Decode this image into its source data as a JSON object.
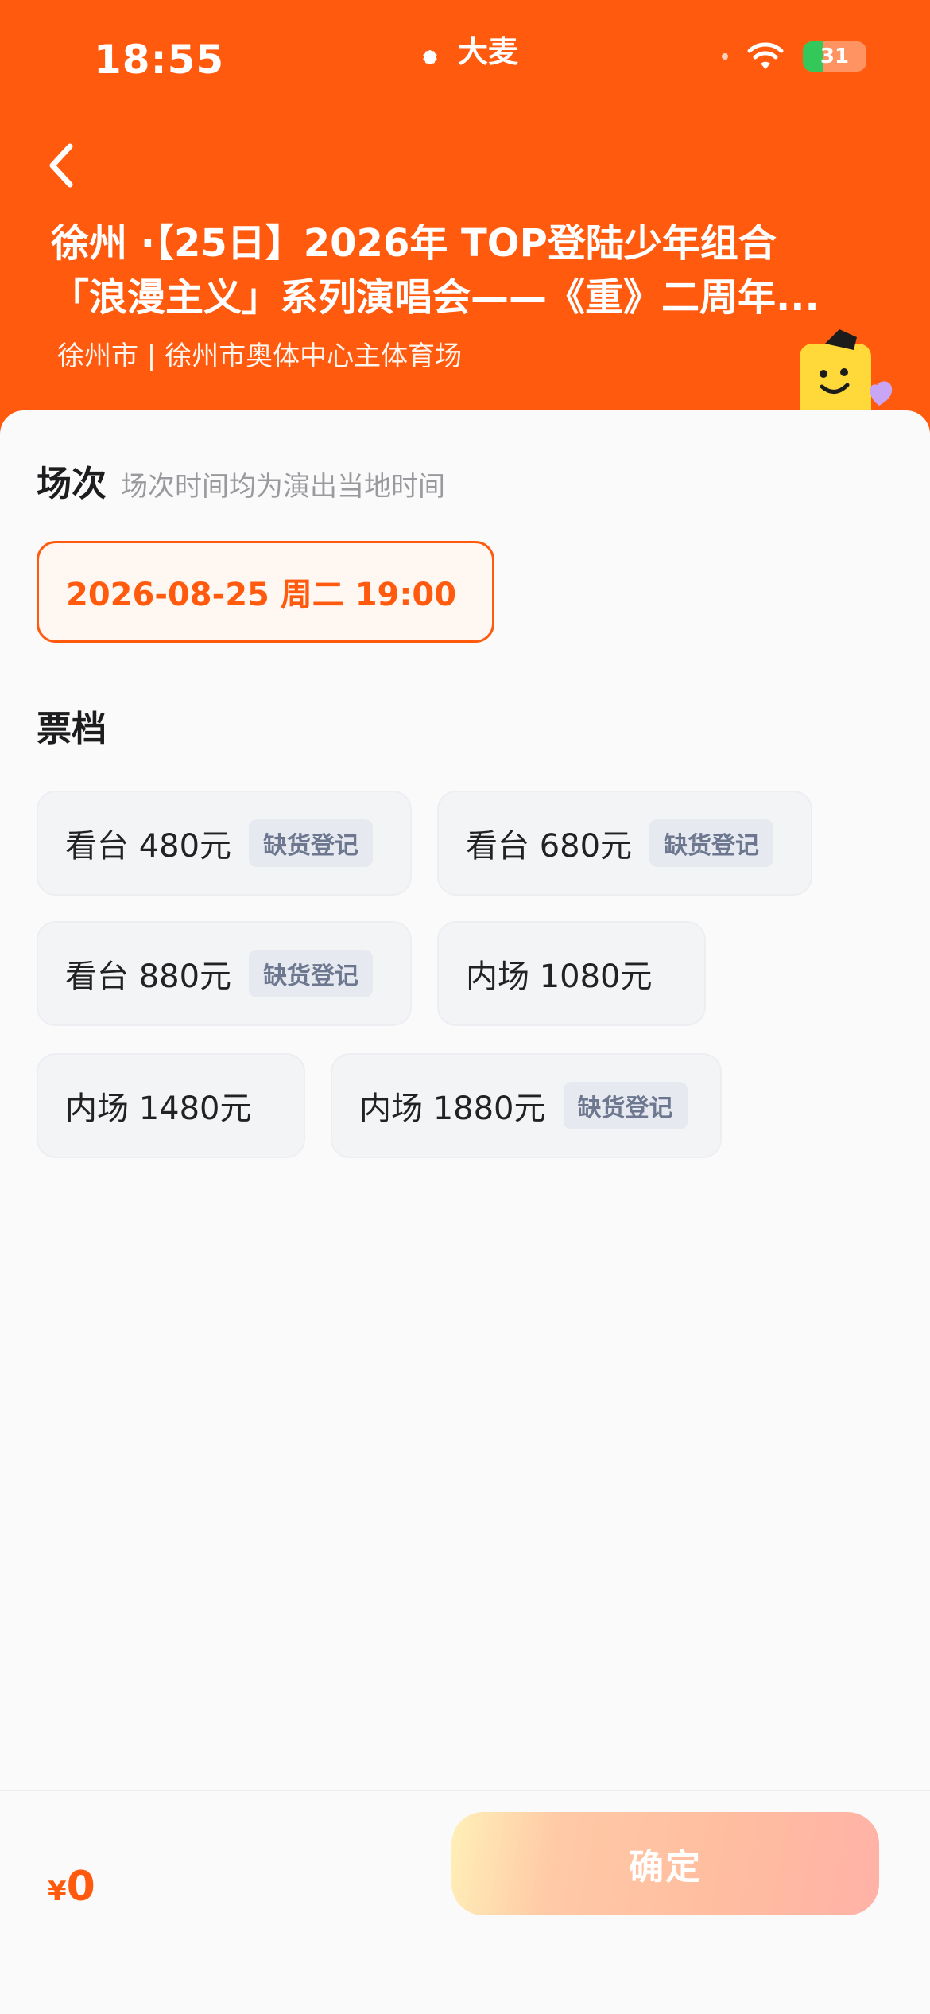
{
  "status_bar": {
    "time": "18:55",
    "brand_name": "大麦",
    "battery_level": "31",
    "battery_percent": 31
  },
  "event": {
    "title_line1": "徐州 ·【25日】2026年 TOP登陆少年组合",
    "title_line2": "「浪漫主义」系列演唱会——《重》二周年...",
    "venue": "徐州市 | 徐州市奥体中心主体育场"
  },
  "session": {
    "title": "场次",
    "subtitle": "场次时间均为演出当地时间",
    "selected": "2026-08-25  周二 19:00"
  },
  "tiers": {
    "title": "票档",
    "items": [
      {
        "label": "看台 480元",
        "tag": "缺货登记"
      },
      {
        "label": "看台 680元",
        "tag": "缺货登记"
      },
      {
        "label": "看台 880元",
        "tag": "缺货登记"
      },
      {
        "label": "内场 1080元",
        "tag": ""
      },
      {
        "label": "内场 1480元",
        "tag": ""
      },
      {
        "label": "内场 1880元",
        "tag": "缺货登记"
      }
    ]
  },
  "footer": {
    "currency": "¥",
    "total": "0",
    "confirm_label": "确定"
  },
  "colors": {
    "brand_orange": "#ff5a0e",
    "tag_text": "#6d7890"
  }
}
